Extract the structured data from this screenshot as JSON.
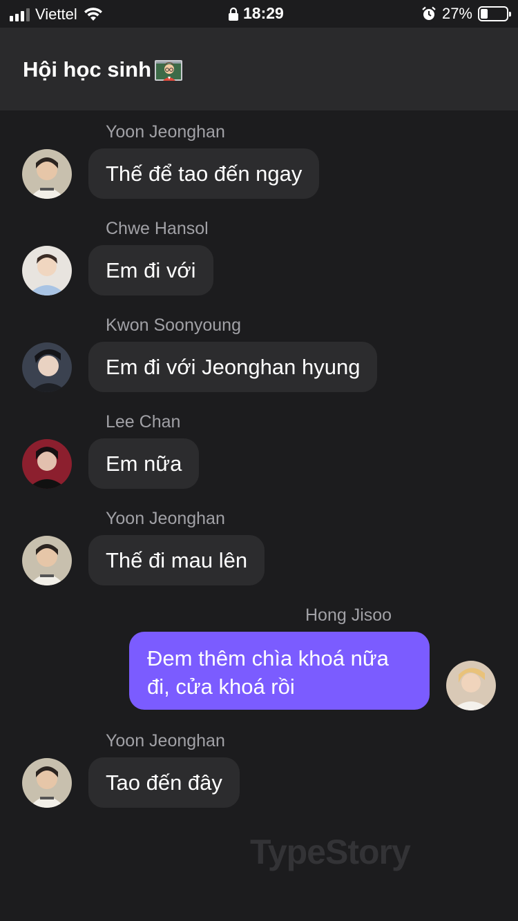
{
  "status_bar": {
    "carrier": "Viettel",
    "time": "18:29",
    "battery_percent": "27%",
    "battery_level": 0.27
  },
  "header": {
    "title": "Hội học sinh"
  },
  "messages": [
    {
      "sender": "Yoon Jeonghan",
      "text": "Thế để tao đến ngay",
      "mine": false
    },
    {
      "sender": "Chwe Hansol",
      "text": "Em đi với",
      "mine": false
    },
    {
      "sender": "Kwon Soonyoung",
      "text": "Em đi với Jeonghan hyung",
      "mine": false
    },
    {
      "sender": "Lee Chan",
      "text": "Em nữa",
      "mine": false
    },
    {
      "sender": "Yoon Jeonghan",
      "text": "Thế đi mau lên",
      "mine": false
    },
    {
      "sender": "Hong Jisoo",
      "text": "Đem thêm chìa khoá nữa đi, cửa khoá rồi",
      "mine": true
    },
    {
      "sender": "Yoon Jeonghan",
      "text": "Tao đến đây",
      "mine": false
    }
  ],
  "watermark": "TypeStory",
  "colors": {
    "background": "#1c1c1e",
    "header": "#2a2a2c",
    "bubble_other": "#2c2c2e",
    "bubble_mine": "#7b5cff",
    "sender_name": "#a1a1a6"
  }
}
